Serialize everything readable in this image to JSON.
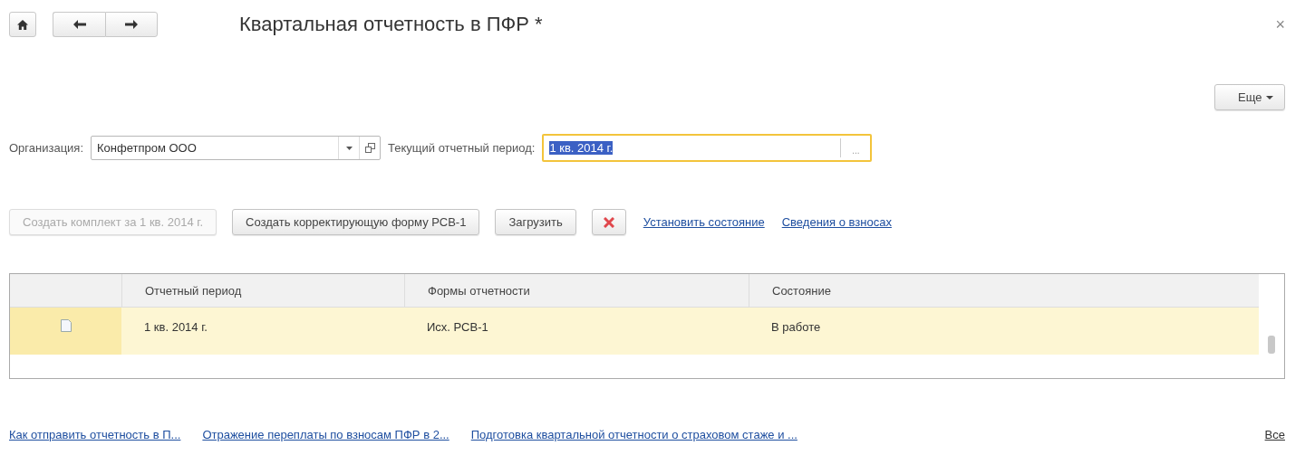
{
  "window": {
    "title": "Квартальная отчетность в ПФР *",
    "close": "×"
  },
  "more_button": {
    "label": "Еще"
  },
  "organization": {
    "label": "Организация:",
    "value": "Конфетпром ООО"
  },
  "period": {
    "label": "Текущий отчетный период:",
    "value": "1 кв. 2014 г.",
    "selected_text": true,
    "focused": true,
    "choose": "..."
  },
  "toolbar": [
    {
      "kind": "button",
      "label": "Создать комплект за 1 кв. 2014 г.",
      "disabled": true
    },
    {
      "kind": "button",
      "label": "Создать корректирующую форму РСВ-1",
      "disabled": false
    },
    {
      "kind": "button",
      "label": "Загрузить",
      "disabled": false
    },
    {
      "kind": "delete",
      "disabled": false
    },
    {
      "kind": "link",
      "label": "Установить состояние",
      "disabled": false
    },
    {
      "kind": "link",
      "label": "Сведения о взносах",
      "disabled": false
    }
  ],
  "table": {
    "columns": [
      "Отчетный период",
      "Формы отчетности",
      "Состояние"
    ],
    "rows": [
      {
        "selected": true,
        "cells": [
          "1 кв. 2014 г.",
          "Исх. РСВ-1",
          "В работе"
        ]
      }
    ]
  },
  "links": [
    "Как отправить отчетность в П...",
    "Отражение переплаты по взносам ПФР в 2...",
    "Подготовка квартальной отчетности о страховом стаже и ..."
  ],
  "all_link": "Все"
}
